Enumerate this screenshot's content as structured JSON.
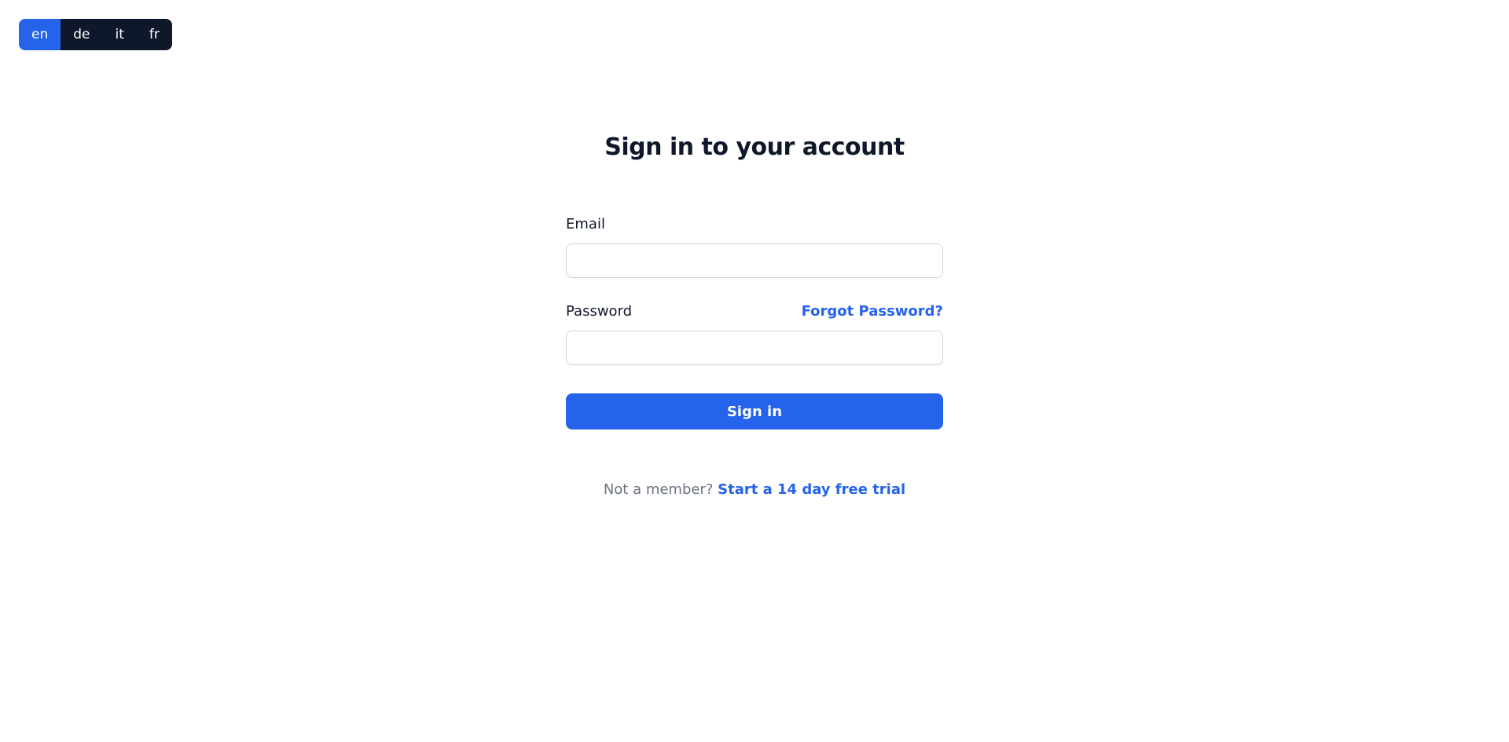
{
  "languages": {
    "items": [
      {
        "code": "en",
        "active": true
      },
      {
        "code": "de",
        "active": false
      },
      {
        "code": "it",
        "active": false
      },
      {
        "code": "fr",
        "active": false
      }
    ]
  },
  "signin": {
    "title": "Sign in to your account",
    "email_label": "Email",
    "email_value": "",
    "password_label": "Password",
    "password_value": "",
    "forgot_password": "Forgot Password?",
    "submit": "Sign in",
    "not_member": "Not a member? ",
    "trial_link": "Start a 14 day free trial"
  }
}
